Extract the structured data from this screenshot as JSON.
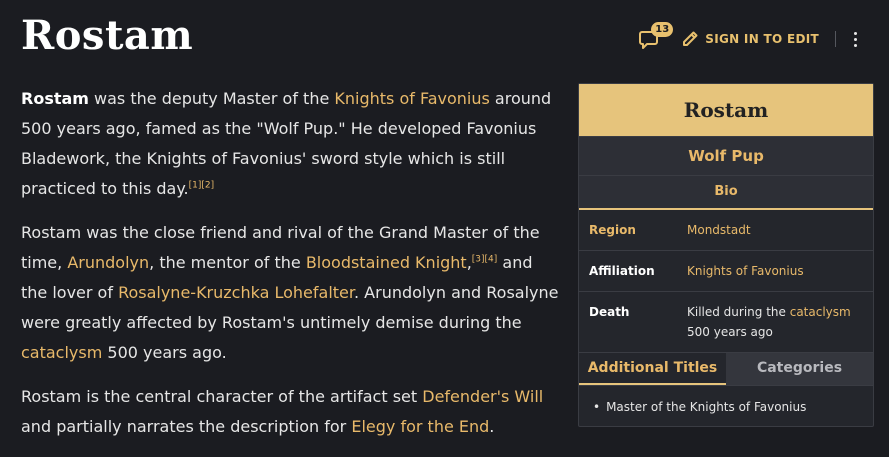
{
  "page": {
    "title": "Rostam"
  },
  "toolbar": {
    "comment_count": "13",
    "sign_in_label": "SIGN IN TO EDIT"
  },
  "article": {
    "p1": {
      "bold": "Rostam",
      "t1": " was the deputy Master of the ",
      "link1": "Knights of Favonius",
      "t2": " around 500 years ago, famed as the \"Wolf Pup.\" He developed Favonius Bladework, the Knights of Favonius' sword style which is still practiced to this day.",
      "ref1": "[1]",
      "ref2": "[2]"
    },
    "p2": {
      "t1": "Rostam was the close friend and rival of the Grand Master of the time, ",
      "link1": "Arundolyn",
      "t2": ", the mentor of the ",
      "link2": "Bloodstained Knight",
      "t3": ",",
      "ref3": "[3]",
      "ref4": "[4]",
      "t4": " and the lover of ",
      "link3": "Rosalyne-Kruzchka Lohefalter",
      "t5": ". Arundolyn and Rosalyne were greatly affected by Rostam's untimely demise during the ",
      "link4": "cataclysm",
      "t6": " 500 years ago."
    },
    "p3": {
      "t1": "Rostam is the central character of the artifact set ",
      "link1": "Defender's Will",
      "t2": " and partially narrates the description for ",
      "link2": "Elegy for the End",
      "t3": "."
    }
  },
  "infobox": {
    "title": "Rostam",
    "subtitle": "Wolf Pup",
    "section": "Bio",
    "rows": [
      {
        "label": "Region",
        "value": "Mondstadt"
      },
      {
        "label": "Affiliation",
        "value": "Knights of Favonius"
      },
      {
        "label": "Death",
        "value_prefix": "Killed during the ",
        "value_link": "cataclysm",
        "value_suffix": "500 years ago"
      }
    ],
    "tabs": [
      "Additional Titles",
      "Categories"
    ],
    "titles": [
      "Master of the Knights of Favonius"
    ]
  },
  "colors": {
    "accent": "#e8b96a",
    "infobox_header": "#e6c47c",
    "background": "#1b1c21"
  }
}
